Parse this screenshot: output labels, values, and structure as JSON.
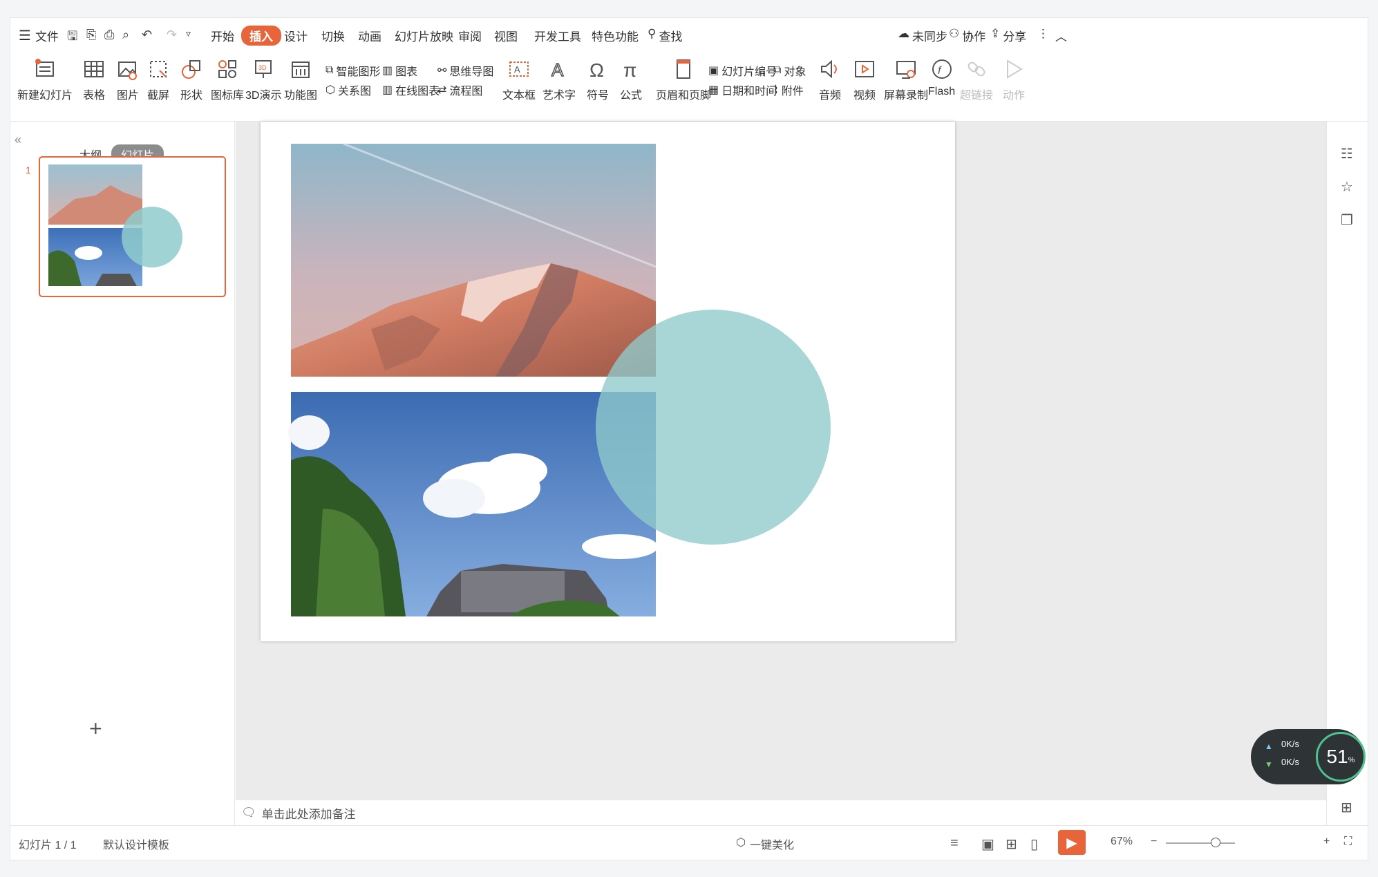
{
  "menu": {
    "file": "文件",
    "tabs": [
      "开始",
      "插入",
      "设计",
      "切换",
      "动画",
      "幻灯片放映",
      "审阅",
      "视图",
      "开发工具",
      "特色功能"
    ],
    "active_tab": "插入",
    "search": "查找",
    "right": {
      "sync": "未同步",
      "collab": "协作",
      "share": "分享"
    }
  },
  "ribbon": {
    "new_slide": "新建幻灯片",
    "table": "表格",
    "picture": "图片",
    "screenshot": "截屏",
    "shape": "形状",
    "icon_lib": "图标库",
    "demo3d": "3D演示",
    "func_chart": "功能图",
    "smart_shape": "智能图形",
    "chart": "图表",
    "mindmap": "思维导图",
    "relation": "关系图",
    "online_chart": "在线图表",
    "flowchart": "流程图",
    "textbox": "文本框",
    "wordart": "艺术字",
    "symbol": "符号",
    "formula": "公式",
    "header_footer": "页眉和页脚",
    "slide_number": "幻灯片编号",
    "object": "对象",
    "date_time": "日期和时间",
    "attachment": "附件",
    "audio": "音频",
    "video": "视频",
    "screen_rec": "屏幕录制",
    "flash": "Flash",
    "hyperlink": "超链接",
    "action": "动作"
  },
  "left_pane": {
    "tab_outline": "大纲",
    "tab_slides": "幻灯片",
    "slide_number": "1"
  },
  "notes_placeholder": "单击此处添加备注",
  "status": {
    "slide_info": "幻灯片 1 / 1",
    "template": "默认设计模板",
    "beautify": "一键美化",
    "zoom": "67%"
  },
  "widget": {
    "up_speed": "0K/s",
    "down_speed": "0K/s",
    "percent": "51"
  },
  "colors": {
    "accent": "#e8653b",
    "circle": "#8fcbcc"
  }
}
